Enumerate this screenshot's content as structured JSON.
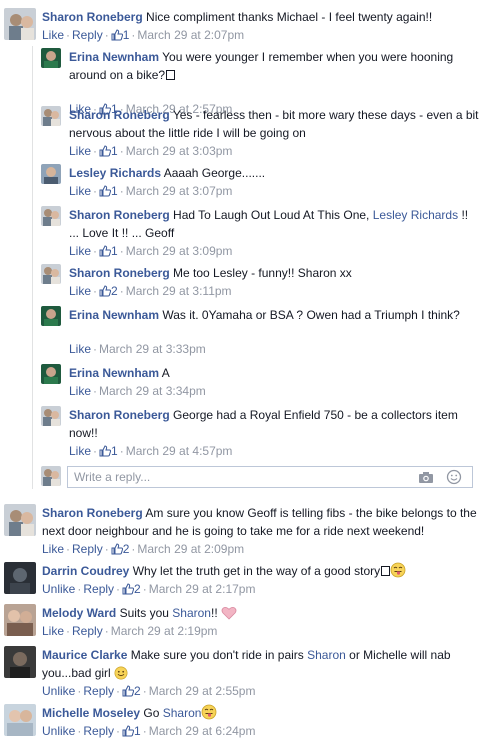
{
  "colors": {
    "link": "#3b5998",
    "meta": "#9197a3",
    "text": "#141823",
    "thread_line": "#e1e2e3"
  },
  "actions": {
    "like": "Like",
    "unlike": "Unlike",
    "reply": "Reply"
  },
  "comments": [
    {
      "name": "Sharon Roneberg",
      "text": "Nice compliment thanks Michael - I feel twenty again!!",
      "likes": "1",
      "time": "March 29 at 2:07pm"
    },
    {
      "name": "Erina Newnham",
      "text": "You were younger I remember when you were hooning around on a bike?",
      "likes": "1",
      "time": "March 29 at 2:57pm"
    },
    {
      "name": "Sharon Roneberg",
      "text": "Yes - fearless then - bit more wary these days - even a bit nervous about the little ride I will be going on",
      "likes": "1",
      "time": "March 29 at 3:03pm"
    },
    {
      "name": "Lesley Richards",
      "text": "Aaaah George.......",
      "likes": "1",
      "time": "March 29 at 3:07pm"
    },
    {
      "name": "Sharon Roneberg",
      "text_a": "Had To Laugh Out Loud At This One,",
      "mention": "Lesley Richards",
      "text_b": "!! ... Love It !! ... Geoff",
      "likes": "1",
      "time": "March 29 at 3:09pm"
    },
    {
      "name": "Sharon Roneberg",
      "text": "Me too Lesley - funny!! Sharon xx",
      "likes": "2",
      "time": "March 29 at 3:11pm"
    },
    {
      "name": "Erina Newnham",
      "text": "Was it. 0Yamaha or BSA ? Owen had a Triumph I think?",
      "time": "March 29 at 3:33pm"
    },
    {
      "name": "Erina Newnham",
      "text": "A",
      "time": "March 29 at 3:34pm"
    },
    {
      "name": "Sharon Roneberg",
      "text": "George had a Royal Enfield 750 - be a collectors item now!!",
      "likes": "1",
      "time": "March 29 at 4:57pm"
    },
    {
      "name": "Sharon Roneberg",
      "text": "Am sure you know Geoff is telling fibs - the bike belongs to the next door neighbour and he is going to take me for a ride next weekend!",
      "likes": "2",
      "time": "March 29 at 2:09pm"
    },
    {
      "name": "Darrin Coudrey",
      "text": "Why let the truth get in the way of a good story",
      "likes": "2",
      "time": "March 29 at 2:17pm"
    },
    {
      "name": "Melody Ward",
      "text_a": "Suits you",
      "mention": "Sharon",
      "text_b": "!!",
      "time": "March 29 at 2:19pm"
    },
    {
      "name": "Maurice Clarke",
      "text_a": "Make sure you don't ride in pairs",
      "mention": "Sharon",
      "text_b": "or Michelle will nab you...bad girl",
      "likes": "2",
      "time": "March 29 at 2:55pm"
    },
    {
      "name": "Michelle Moseley",
      "text_a": "Go",
      "mention": "Sharon",
      "likes": "1",
      "time": "March 29 at 6:24pm"
    }
  ],
  "reply_box": {
    "placeholder": "Write a reply..."
  }
}
